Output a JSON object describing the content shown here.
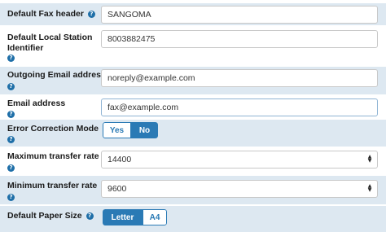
{
  "fields": {
    "fax_header": {
      "label": "Default Fax header",
      "value": "SANGOMA"
    },
    "station_id": {
      "label": "Default Local Station Identifier",
      "value": "8003882475"
    },
    "outgoing_email": {
      "label": "Outgoing Email address",
      "value": "noreply@example.com"
    },
    "email": {
      "label": "Email address",
      "value": "fax@example.com"
    },
    "ecm": {
      "label": "Error Correction Mode",
      "options": [
        "Yes",
        "No"
      ],
      "selected": "No"
    },
    "max_rate": {
      "label": "Maximum transfer rate",
      "value": "14400"
    },
    "min_rate": {
      "label": "Minimum transfer rate",
      "value": "9600"
    },
    "paper_size": {
      "label": "Default Paper Size",
      "options": [
        "Letter",
        "A4"
      ],
      "selected": "Letter"
    }
  },
  "help_glyph": "?",
  "icons": {
    "help": "question-circle-icon",
    "select": "updown-arrows-icon"
  },
  "colors": {
    "accent": "#2a7ab5",
    "row_shade": "#dde8f1",
    "help": "#1f6fa8"
  }
}
